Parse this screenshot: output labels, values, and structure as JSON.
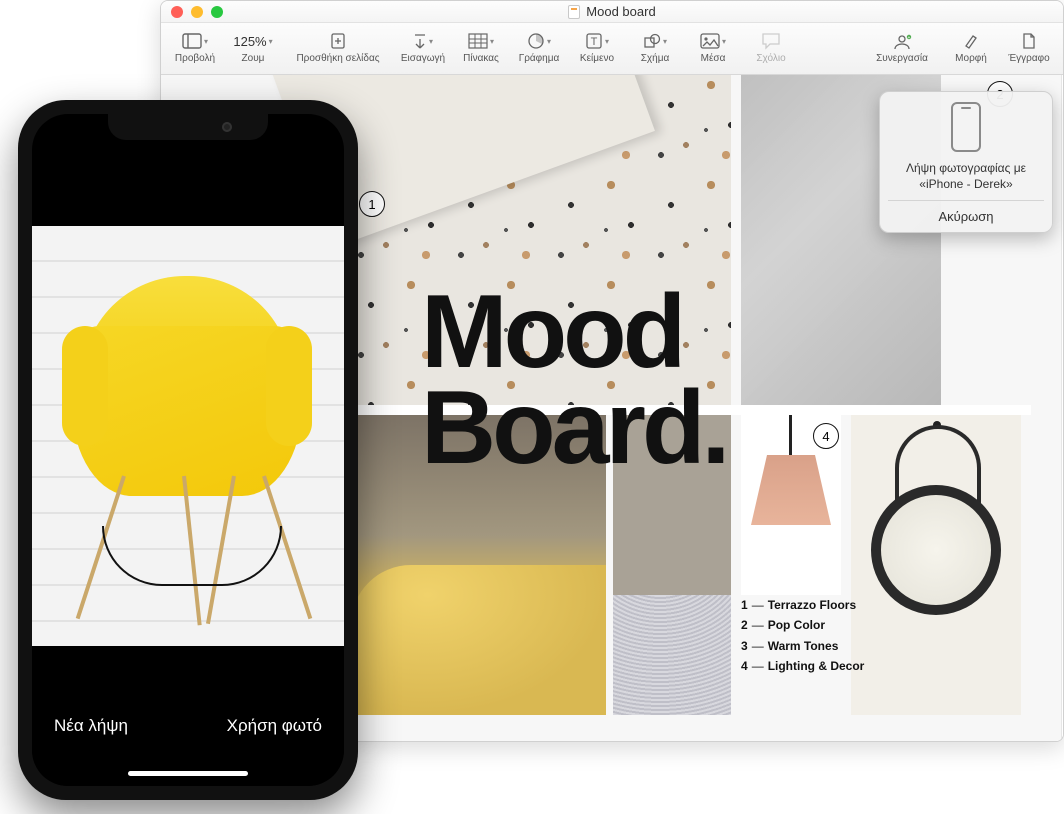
{
  "window": {
    "title": "Mood board",
    "traffic": {
      "close": "close",
      "min": "minimize",
      "max": "fullscreen"
    }
  },
  "toolbar": {
    "view": "Προβολή",
    "zoom_value": "125%",
    "zoom_label": "Ζουμ",
    "add_page": "Προσθήκη σελίδας",
    "insert": "Εισαγωγή",
    "table": "Πίνακας",
    "chart": "Γράφημα",
    "text": "Κείμενο",
    "shape": "Σχήμα",
    "media": "Μέσα",
    "comment": "Σχόλιο",
    "collaborate": "Συνεργασία",
    "format": "Μορφή",
    "document": "Έγγραφο"
  },
  "document": {
    "title_line1": "Mood",
    "title_line2": "Board.",
    "callouts": {
      "c1": "1",
      "c2": "2",
      "c4": "4"
    },
    "legend": {
      "i1_num": "1",
      "i1_text": "Terrazzo Floors",
      "i2_num": "2",
      "i2_text": "Pop Color",
      "i3_num": "3",
      "i3_text": "Warm Tones",
      "i4_num": "4",
      "i4_text": "Lighting & Decor",
      "sep": "—"
    }
  },
  "popover": {
    "line1": "Λήψη φωτογραφίας με",
    "line2": "«iPhone - Derek»",
    "cancel": "Ακύρωση"
  },
  "iphone": {
    "retake": "Νέα λήψη",
    "use_photo": "Χρήση φωτό"
  }
}
